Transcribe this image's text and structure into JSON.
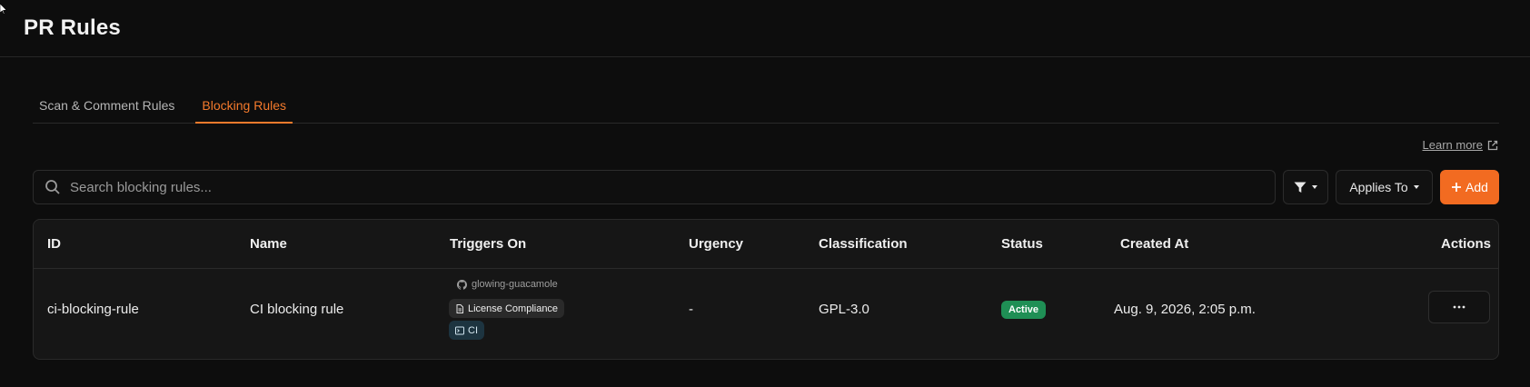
{
  "header": {
    "title": "PR Rules"
  },
  "tabs": [
    {
      "label": "Scan & Comment Rules",
      "active": false
    },
    {
      "label": "Blocking Rules",
      "active": true
    }
  ],
  "learn_more": {
    "label": "Learn more"
  },
  "toolbar": {
    "search_placeholder": "Search blocking rules...",
    "search_value": "",
    "applies_to_label": "Applies To",
    "add_label": "Add"
  },
  "table": {
    "columns": [
      "ID",
      "Name",
      "Triggers On",
      "Urgency",
      "Classification",
      "Status",
      "Created At",
      "Actions"
    ],
    "rows": [
      {
        "id": "ci-blocking-rule",
        "name": "CI blocking rule",
        "trigger_repo": "glowing-guacamole",
        "trigger_type": "License Compliance",
        "trigger_ci": "CI",
        "urgency": "-",
        "classification": "GPL-3.0",
        "status": "Active",
        "created_at": "Aug. 9, 2026, 2:05 p.m."
      }
    ]
  },
  "colors": {
    "accent": "#f26b21",
    "status_active": "#1f8f55",
    "background": "#0d0d0d"
  },
  "icons": {
    "search": "search-icon",
    "filter": "filter-icon",
    "add": "plus-icon",
    "external": "external-link-icon",
    "github": "github-icon",
    "document": "document-icon",
    "terminal": "terminal-icon",
    "more": "more-horizontal-icon"
  }
}
